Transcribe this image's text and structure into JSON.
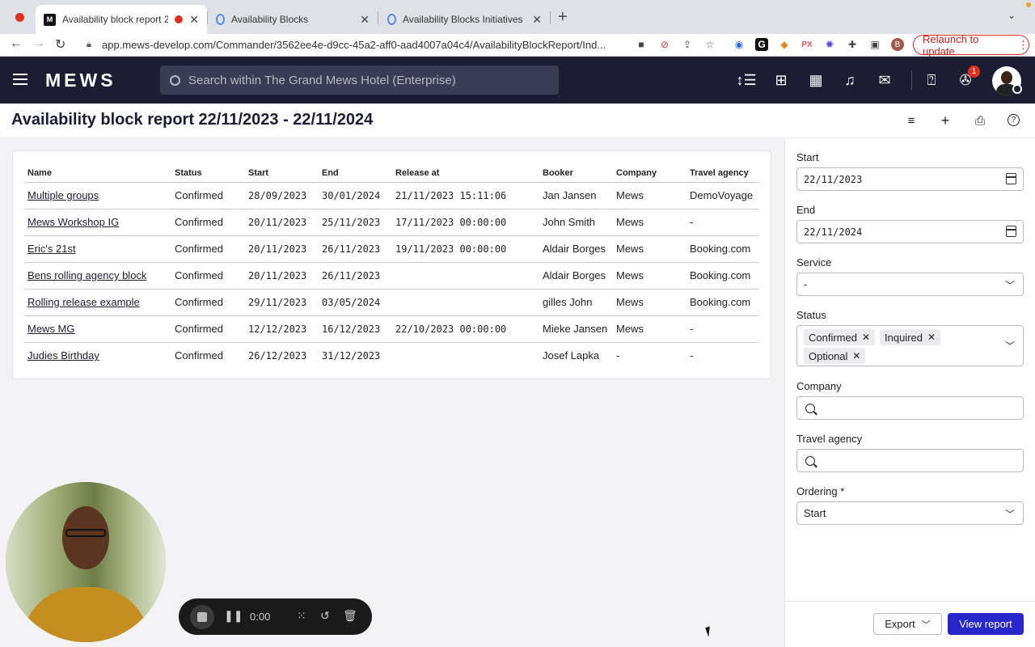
{
  "browser": {
    "tabs": [
      {
        "title": "Availability block report 22/",
        "active": true
      },
      {
        "title": "Availability Blocks",
        "active": false
      },
      {
        "title": "Availability Blocks Initiatives",
        "active": false
      }
    ],
    "new_tab": "+",
    "url": "app.mews-develop.com/Commander/3562ee4e-d9cc-45a2-aff0-aad4007a04c4/AvailabilityBlockReport/Ind...",
    "relaunch_label": "Relaunch to update",
    "profile_initial": "B"
  },
  "app": {
    "logo": "MEWS",
    "search_placeholder": "Search within The Grand Mews Hotel (Enterprise)",
    "notification_count": "1"
  },
  "page": {
    "title": "Availability block report 22/11/2023 - 22/11/2024"
  },
  "table": {
    "columns": [
      "Name",
      "Status",
      "Start",
      "End",
      "Release at",
      "Booker",
      "Company",
      "Travel agency"
    ],
    "rows": [
      {
        "name": "Multiple groups",
        "status": "Confirmed",
        "start": "28/09/2023",
        "end": "30/01/2024",
        "release": "21/11/2023 15:11:06",
        "booker": "Jan Jansen",
        "company": "Mews",
        "agency": "DemoVoyage"
      },
      {
        "name": "Mews Workshop IG",
        "status": "Confirmed",
        "start": "20/11/2023",
        "end": "25/11/2023",
        "release": "17/11/2023 00:00:00",
        "booker": "John Smith",
        "company": "Mews",
        "agency": "-"
      },
      {
        "name": "Eric's 21st",
        "status": "Confirmed",
        "start": "20/11/2023",
        "end": "26/11/2023",
        "release": "19/11/2023 00:00:00",
        "booker": "Aldair Borges",
        "company": "Mews",
        "agency": "Booking.com"
      },
      {
        "name": "Bens rolling agency block",
        "status": "Confirmed",
        "start": "20/11/2023",
        "end": "26/11/2023",
        "release": "",
        "booker": "Aldair Borges",
        "company": "Mews",
        "agency": "Booking.com"
      },
      {
        "name": "Rolling release example",
        "status": "Confirmed",
        "start": "29/11/2023",
        "end": "03/05/2024",
        "release": "",
        "booker": "gilles John",
        "company": "Mews",
        "agency": "Booking.com"
      },
      {
        "name": "Mews MG",
        "status": "Confirmed",
        "start": "12/12/2023",
        "end": "16/12/2023",
        "release": "22/10/2023 00:00:00",
        "booker": "Mieke Jansen",
        "company": "Mews",
        "agency": "-"
      },
      {
        "name": "Judies Birthday",
        "status": "Confirmed",
        "start": "26/12/2023",
        "end": "31/12/2023",
        "release": "",
        "booker": "Josef Lapka",
        "company": "-",
        "agency": "-"
      }
    ]
  },
  "filters": {
    "start_label": "Start",
    "start_value": "22/11/2023",
    "end_label": "End",
    "end_value": "22/11/2024",
    "service_label": "Service",
    "service_value": "-",
    "status_label": "Status",
    "status_chips": [
      "Confirmed",
      "Inquired",
      "Optional"
    ],
    "company_label": "Company",
    "travel_agency_label": "Travel agency",
    "ordering_label": "Ordering *",
    "ordering_value": "Start",
    "export_label": "Export",
    "view_report_label": "View report"
  },
  "recorder": {
    "time": "0:00"
  }
}
